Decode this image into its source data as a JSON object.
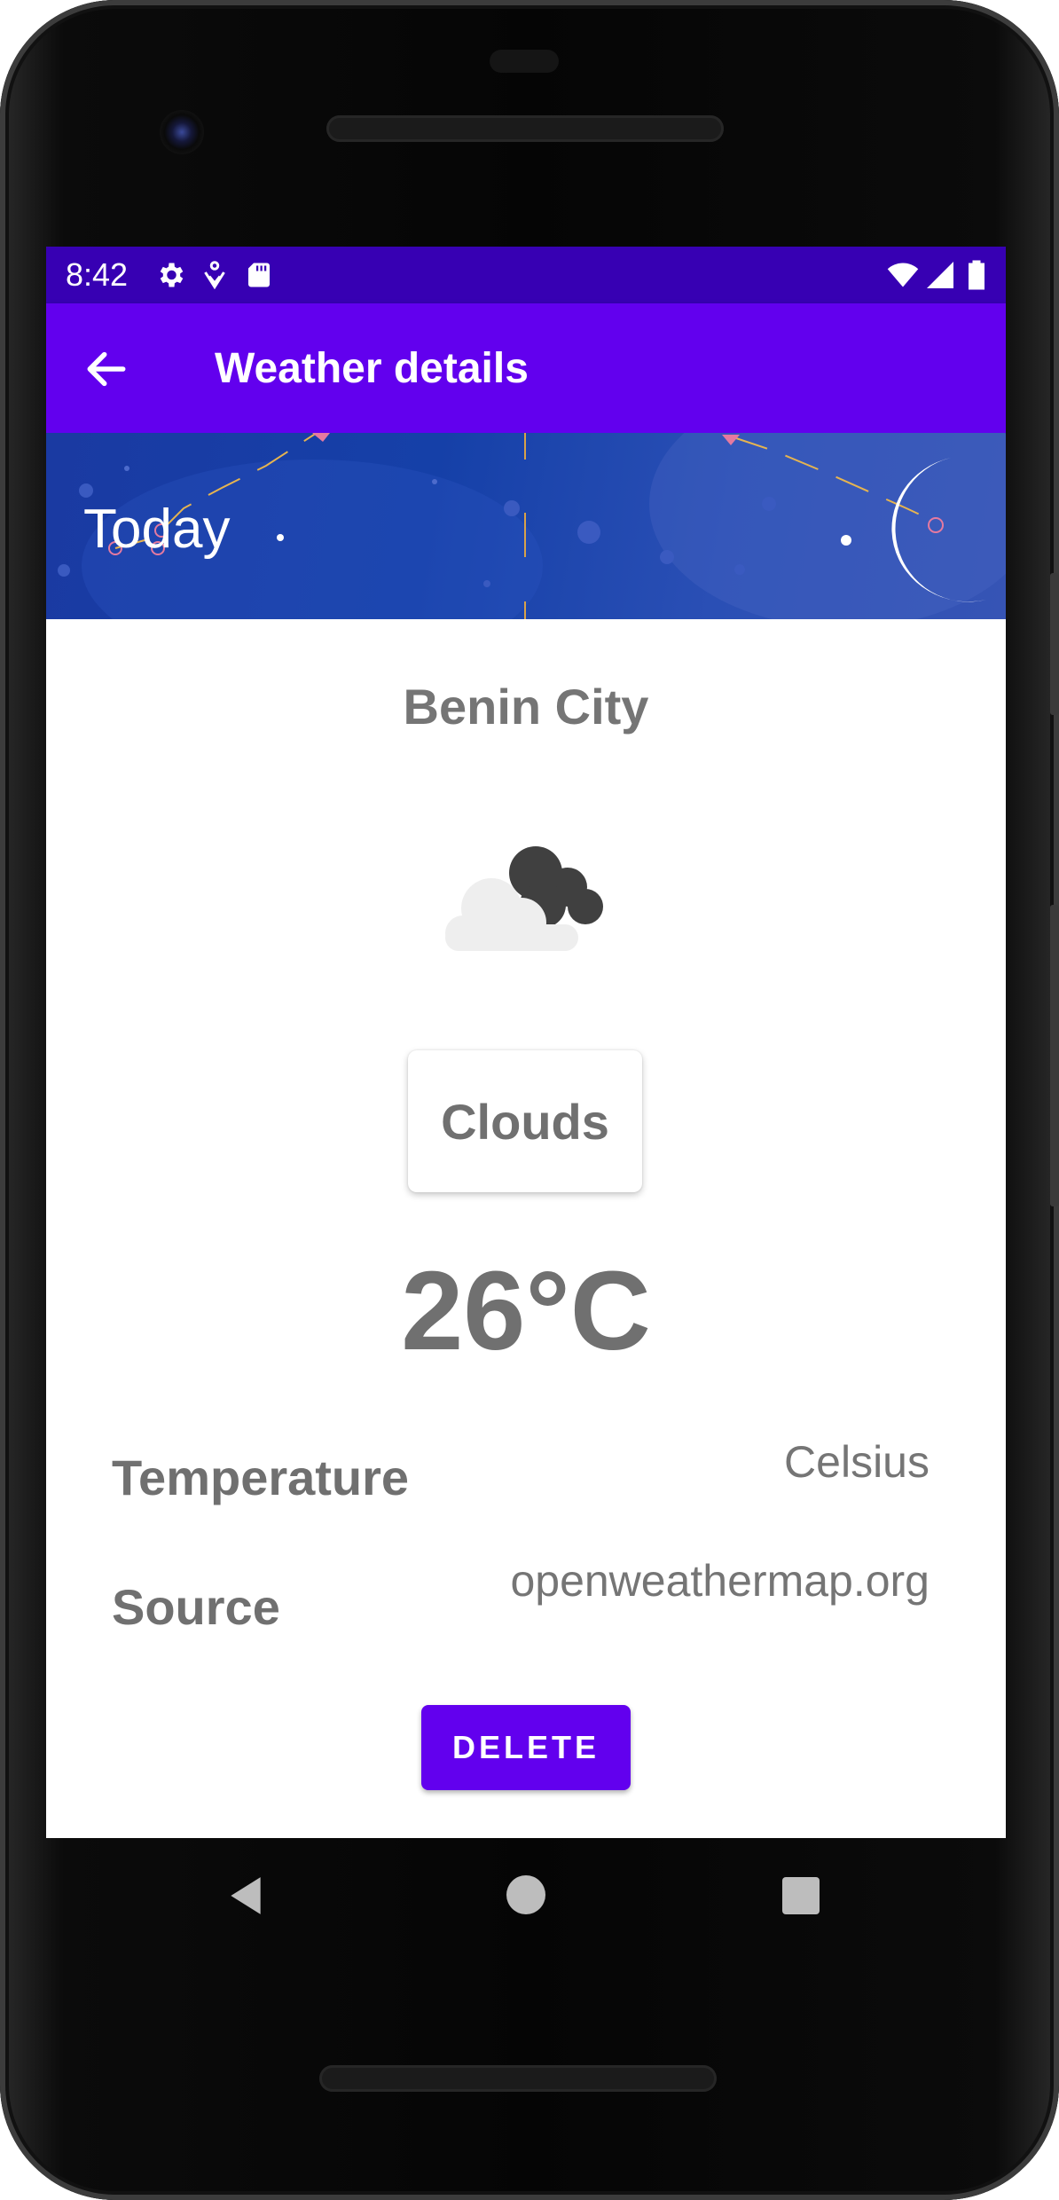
{
  "status_bar": {
    "time": "8:42",
    "icons": [
      "settings-icon",
      "accessibility-icon",
      "sd-card-icon",
      "wifi-icon",
      "signal-icon",
      "battery-icon"
    ]
  },
  "app_bar": {
    "title": "Weather details",
    "back_icon": "arrow-back-icon"
  },
  "banner": {
    "label": "Today",
    "art": "night-sky-moon-constellation"
  },
  "details": {
    "city": "Benin City",
    "condition_icon": "clouds-icon",
    "condition": "Clouds",
    "temperature": "26°C",
    "rows": [
      {
        "label": "Temperature",
        "value": "Celsius"
      },
      {
        "label": "Source",
        "value": "openweathermap.org"
      }
    ],
    "delete_label": "DELETE"
  },
  "colors": {
    "status_bar": "#3700b3",
    "app_bar": "#6200ee",
    "banner": "#1a3aa2",
    "text_gray": "#707070",
    "button": "#6200ee"
  },
  "nav_bar": {
    "buttons": [
      "nav-back-icon",
      "nav-home-icon",
      "nav-recents-icon"
    ]
  }
}
